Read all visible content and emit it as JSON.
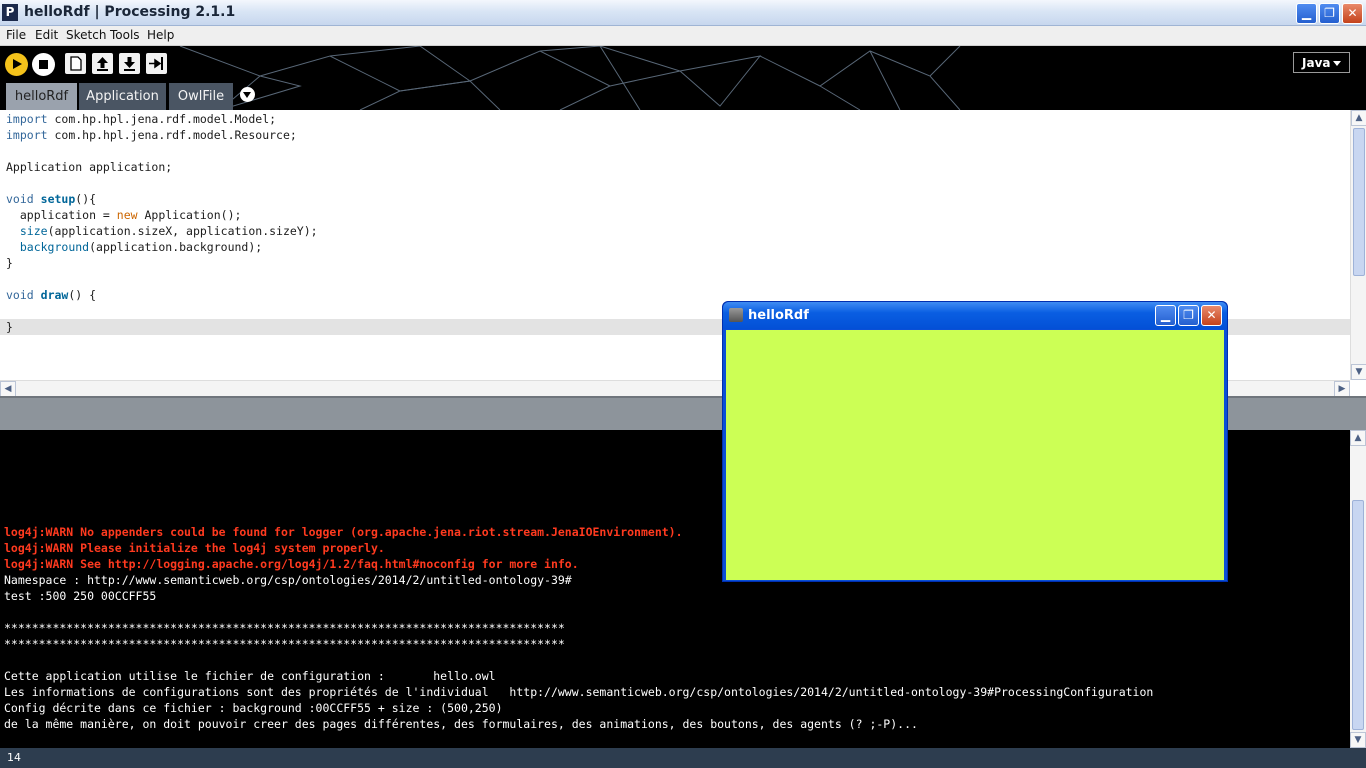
{
  "window": {
    "title": "helloRdf | Processing 2.1.1",
    "logo": "P",
    "minimize": "▁",
    "maximize": "❐",
    "close": "✕"
  },
  "menu": [
    "File",
    "Edit",
    "Sketch",
    "Tools",
    "Help"
  ],
  "toolbar": {
    "buttons": [
      "run-icon",
      "stop-icon",
      "new-icon",
      "open-icon",
      "save-icon",
      "export-icon"
    ],
    "mode": "Java"
  },
  "tabs": [
    {
      "label": "helloRdf",
      "active": true
    },
    {
      "label": "Application",
      "active": false
    },
    {
      "label": "OwlFile",
      "active": false
    }
  ],
  "editor": {
    "lines": [
      "import com.hp.hpl.jena.rdf.model.Model;",
      "import com.hp.hpl.jena.rdf.model.Resource;",
      "",
      "Application application;",
      "",
      "void setup(){",
      "  application = new Application();",
      "  size(application.sizeX, application.sizeY);",
      "  background(application.background);",
      "}",
      "",
      "void draw() {",
      "",
      "}"
    ]
  },
  "console": {
    "lines": [
      {
        "text": "log4j:WARN No appenders could be found for logger (org.apache.jena.riot.stream.JenaIOEnvironment).",
        "type": "error"
      },
      {
        "text": "log4j:WARN Please initialize the log4j system properly.",
        "type": "error"
      },
      {
        "text": "log4j:WARN See http://logging.apache.org/log4j/1.2/faq.html#noconfig for more info.",
        "type": "error"
      },
      {
        "text": "Namespace : http://www.semanticweb.org/csp/ontologies/2014/2/untitled-ontology-39#",
        "type": "out"
      },
      {
        "text": "test :500 250 00CCFF55",
        "type": "out"
      },
      {
        "text": "",
        "type": "out"
      },
      {
        "text": "*********************************************************************************",
        "type": "out"
      },
      {
        "text": "*********************************************************************************",
        "type": "out"
      },
      {
        "text": "",
        "type": "out"
      },
      {
        "text": "Cette application utilise le fichier de configuration :       hello.owl",
        "type": "out"
      },
      {
        "text": "Les informations de configurations sont des propriétés de l'individual   http://www.semanticweb.org/csp/ontologies/2014/2/untitled-ontology-39#ProcessingConfiguration",
        "type": "out"
      },
      {
        "text": "Config décrite dans ce fichier : background :00CCFF55 + size : (500,250)",
        "type": "out"
      },
      {
        "text": "de la même manière, on doit pouvoir creer des pages différentes, des formulaires, des animations, des boutons, des agents (? ;-P)...",
        "type": "out"
      }
    ]
  },
  "status": {
    "line": "14"
  },
  "sketch_window": {
    "title": "helloRdf",
    "background": "#CCFF55"
  },
  "colors": {
    "console_error": "#FF3A1F",
    "header_bg": "#000000",
    "status_bg": "#2D3D4F"
  }
}
